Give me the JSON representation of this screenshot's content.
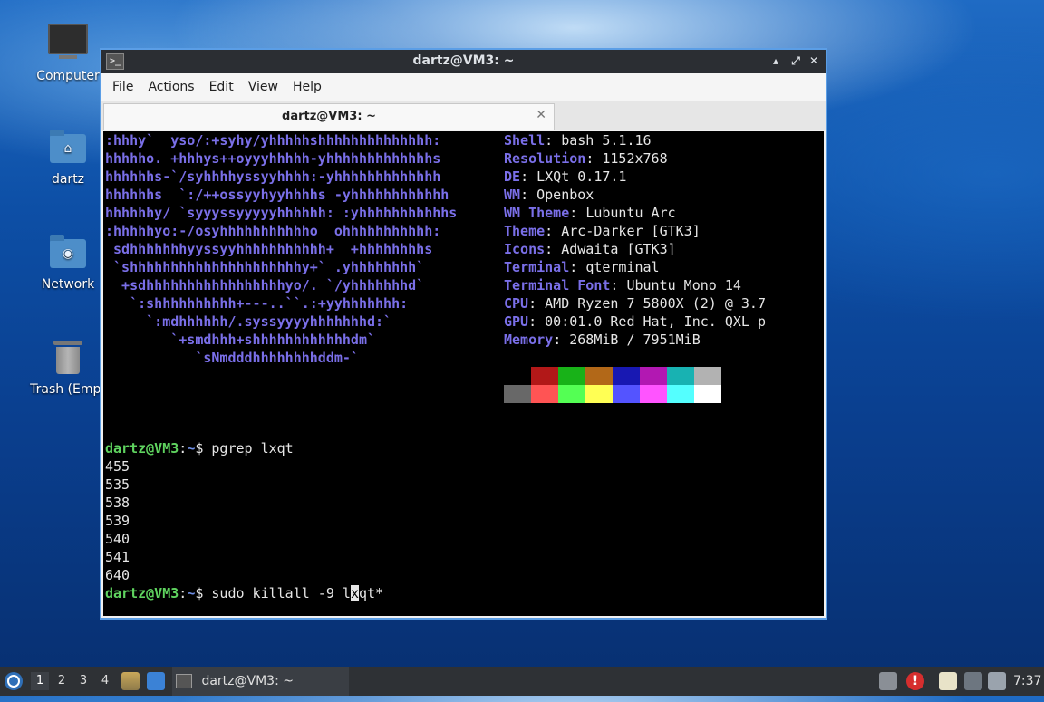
{
  "desktop": {
    "icons": [
      {
        "label": "Computer"
      },
      {
        "label": "dartz"
      },
      {
        "label": "Network"
      },
      {
        "label": "Trash (Empt"
      }
    ]
  },
  "window": {
    "title": "dartz@VM3: ~",
    "app_icon_glyph": ">_",
    "controls": {
      "minimize": "▴",
      "maximize": "⤢",
      "close": "✕"
    },
    "menu": [
      "File",
      "Actions",
      "Edit",
      "View",
      "Help"
    ],
    "tab": {
      "label": "dartz@VM3: ~",
      "close": "✕"
    }
  },
  "terminal": {
    "logo_lines": [
      ":hhhy`  yso/:+syhy/yhhhhhshhhhhhhhhhhhhh:",
      "hhhhho. +hhhys++oyyyhhhhh-yhhhhhhhhhhhhhs",
      "hhhhhhs-`/syhhhhyssyyhhhh:-yhhhhhhhhhhhhh",
      "hhhhhhs  `:/++ossyyhyyhhhhs -yhhhhhhhhhhhh",
      "hhhhhhy/ `syyyssyyyyyhhhhhh: :yhhhhhhhhhhhs",
      ":hhhhhyo:-/osyhhhhhhhhhhho  ohhhhhhhhhhh:",
      " sdhhhhhhhyyssyyhhhhhhhhhhh+  +hhhhhhhhs",
      " `shhhhhhhhhhhhhhhhhhhhhy+` .yhhhhhhhh`",
      "  +sdhhhhhhhhhhhhhhhhhyo/. `/yhhhhhhhd`",
      "   `:shhhhhhhhhh+---..``.:+yyhhhhhhh:",
      "     `:mdhhhhhh/.syssyyyyhhhhhhhd:`",
      "        `+smdhhh+shhhhhhhhhhhhdm`",
      "           `sNmdddhhhhhhhhddm-`"
    ],
    "info": [
      {
        "key": "Shell",
        "value": "bash 5.1.16"
      },
      {
        "key": "Resolution",
        "value": "1152x768"
      },
      {
        "key": "DE",
        "value": "LXQt 0.17.1"
      },
      {
        "key": "WM",
        "value": "Openbox"
      },
      {
        "key": "WM Theme",
        "value": "Lubuntu Arc"
      },
      {
        "key": "Theme",
        "value": "Arc-Darker [GTK3]"
      },
      {
        "key": "Icons",
        "value": "Adwaita [GTK3]"
      },
      {
        "key": "Terminal",
        "value": "qterminal"
      },
      {
        "key": "Terminal Font",
        "value": "Ubuntu Mono 14"
      },
      {
        "key": "CPU",
        "value": "AMD Ryzen 7 5800X (2) @ 3.7"
      },
      {
        "key": "GPU",
        "value": "00:01.0 Red Hat, Inc. QXL p"
      },
      {
        "key": "Memory",
        "value": "268MiB / 7951MiB"
      }
    ],
    "palette_top": [
      "#000000",
      "#b21818",
      "#18b218",
      "#b26818",
      "#1818b2",
      "#b218b2",
      "#18b2b2",
      "#b2b2b2"
    ],
    "palette_bottom": [
      "#686868",
      "#ff5454",
      "#54ff54",
      "#ffff54",
      "#5454ff",
      "#ff54ff",
      "#54ffff",
      "#ffffff"
    ],
    "prompt_user": "dartz@VM3",
    "prompt_sep": ":",
    "prompt_path": "~",
    "prompt_sym": "$ ",
    "command1": "pgrep lxqt",
    "output": [
      "455",
      "535",
      "538",
      "539",
      "540",
      "541",
      "640"
    ],
    "command2_before": "sudo killall -9 l",
    "command2_cursor": "x",
    "command2_after": "qt*"
  },
  "taskbar": {
    "desktops": [
      "1",
      "2",
      "3",
      "4"
    ],
    "active_desktop": "1",
    "task_label": "dartz@VM3: ~",
    "clock": "7:37"
  }
}
